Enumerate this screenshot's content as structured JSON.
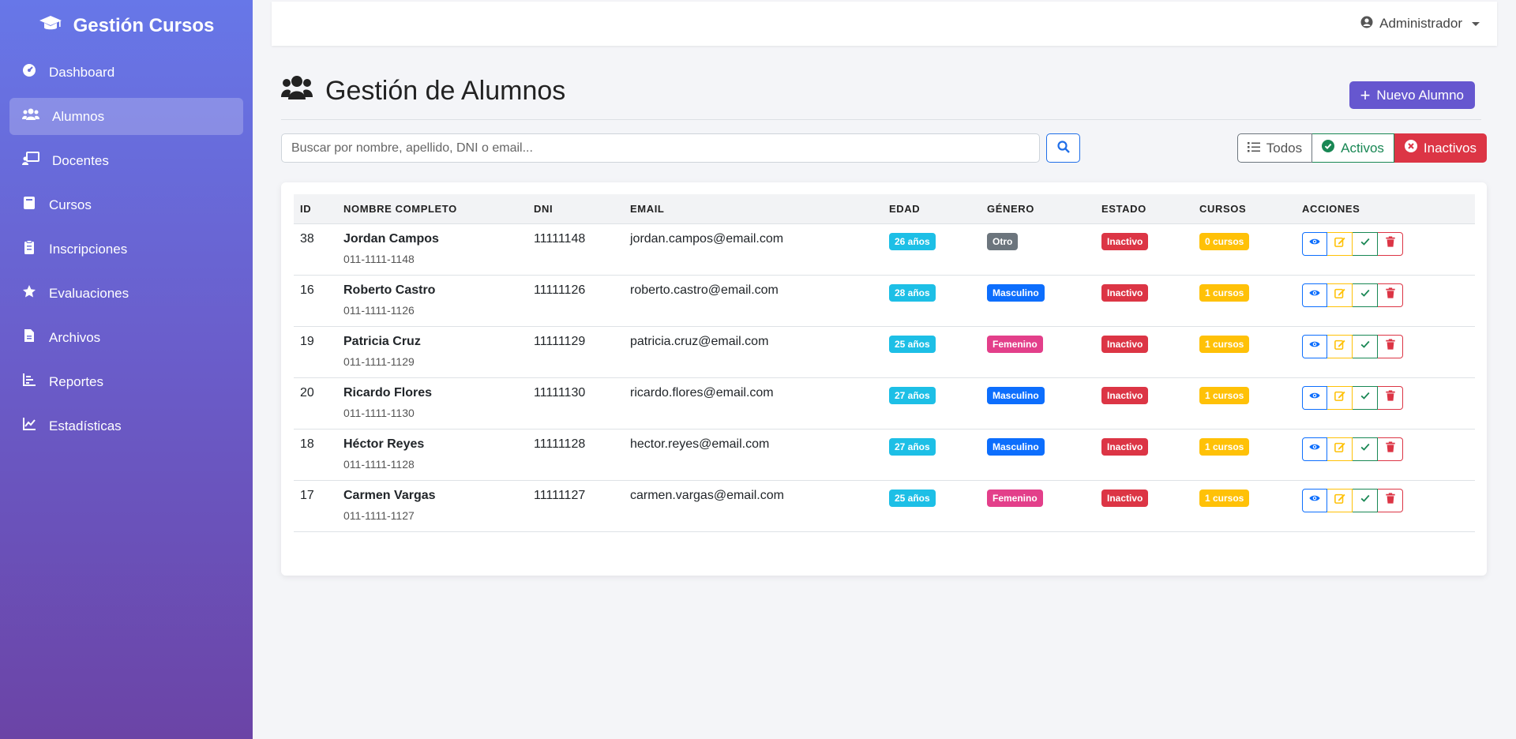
{
  "brand": {
    "title": "Gestión Cursos",
    "icon": "graduation-cap-icon"
  },
  "sidebar": {
    "items": [
      {
        "label": "Dashboard",
        "icon": "dashboard-icon",
        "active": false
      },
      {
        "label": "Alumnos",
        "icon": "users-icon",
        "active": true
      },
      {
        "label": "Docentes",
        "icon": "teacher-icon",
        "active": false
      },
      {
        "label": "Cursos",
        "icon": "book-icon",
        "active": false
      },
      {
        "label": "Inscripciones",
        "icon": "clipboard-icon",
        "active": false
      },
      {
        "label": "Evaluaciones",
        "icon": "star-icon",
        "active": false
      },
      {
        "label": "Archivos",
        "icon": "file-icon",
        "active": false
      },
      {
        "label": "Reportes",
        "icon": "bar-chart-icon",
        "active": false
      },
      {
        "label": "Estadísticas",
        "icon": "line-chart-icon",
        "active": false
      }
    ]
  },
  "topbar": {
    "user": "Administrador"
  },
  "page": {
    "title": "Gestión de Alumnos",
    "new_button": "Nuevo Alumno"
  },
  "search": {
    "placeholder": "Buscar por nombre, apellido, DNI o email..."
  },
  "filters": {
    "all": "Todos",
    "active": "Activos",
    "inactive": "Inactivos"
  },
  "table": {
    "headers": [
      "ID",
      "NOMBRE COMPLETO",
      "DNI",
      "EMAIL",
      "EDAD",
      "GÉNERO",
      "ESTADO",
      "CURSOS",
      "ACCIONES"
    ],
    "rows": [
      {
        "id": "38",
        "name": "Jordan Campos",
        "phone": "011-1111-1148",
        "dni": "11111148",
        "email": "jordan.campos@email.com",
        "age": "26 años",
        "gender": "Otro",
        "status": "Inactivo",
        "courses": "0 cursos"
      },
      {
        "id": "16",
        "name": "Roberto Castro",
        "phone": "011-1111-1126",
        "dni": "11111126",
        "email": "roberto.castro@email.com",
        "age": "28 años",
        "gender": "Masculino",
        "status": "Inactivo",
        "courses": "1 cursos"
      },
      {
        "id": "19",
        "name": "Patricia Cruz",
        "phone": "011-1111-1129",
        "dni": "11111129",
        "email": "patricia.cruz@email.com",
        "age": "25 años",
        "gender": "Femenino",
        "status": "Inactivo",
        "courses": "1 cursos"
      },
      {
        "id": "20",
        "name": "Ricardo Flores",
        "phone": "011-1111-1130",
        "dni": "11111130",
        "email": "ricardo.flores@email.com",
        "age": "27 años",
        "gender": "Masculino",
        "status": "Inactivo",
        "courses": "1 cursos"
      },
      {
        "id": "18",
        "name": "Héctor Reyes",
        "phone": "011-1111-1128",
        "dni": "11111128",
        "email": "hector.reyes@email.com",
        "age": "27 años",
        "gender": "Masculino",
        "status": "Inactivo",
        "courses": "1 cursos"
      },
      {
        "id": "17",
        "name": "Carmen Vargas",
        "phone": "011-1111-1127",
        "dni": "11111127",
        "email": "carmen.vargas@email.com",
        "age": "25 años",
        "gender": "Femenino",
        "status": "Inactivo",
        "courses": "1 cursos"
      }
    ]
  },
  "colors": {
    "sidebar_top": "#6777e8",
    "sidebar_bottom": "#6b44a6",
    "primary": "#6657cf",
    "age_badge": "#1dbfe6",
    "male_badge": "#0d6efd",
    "female_badge": "#e33f8a",
    "other_badge": "#6c757d",
    "status_inactive": "#dc3545",
    "courses_badge": "#ffc107"
  }
}
